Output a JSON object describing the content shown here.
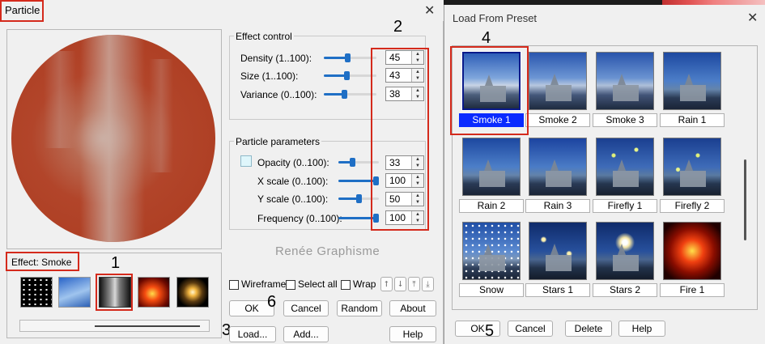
{
  "particle_dialog": {
    "title": "Particle",
    "effect_label": "Effect: Smoke",
    "watermark": "Renée Graphisme",
    "effect_control": {
      "legend": "Effect control",
      "rows": [
        {
          "label": "Density (1..100):",
          "value": "45",
          "level": 0.45
        },
        {
          "label": "Size (1..100):",
          "value": "43",
          "level": 0.43
        },
        {
          "label": "Variance (0..100):",
          "value": "38",
          "level": 0.38
        }
      ]
    },
    "particle_parameters": {
      "legend": "Particle parameters",
      "rows": [
        {
          "label": "Opacity (0..100):",
          "value": "33",
          "level": 0.33
        },
        {
          "label": "X scale (0..100):",
          "value": "100",
          "level": 1.0
        },
        {
          "label": "Y scale (0..100):",
          "value": "50",
          "level": 0.5
        },
        {
          "label": "Frequency (0..100):",
          "value": "100",
          "level": 1.0
        }
      ]
    },
    "checkboxes": {
      "wireframe": "Wireframe",
      "select_all": "Select all",
      "wrap": "Wrap"
    },
    "buttons": {
      "ok": "OK",
      "cancel": "Cancel",
      "random": "Random",
      "about": "About",
      "load": "Load...",
      "add": "Add...",
      "help": "Help"
    },
    "effect_thumbs": [
      "stars",
      "sky",
      "smoke",
      "fire",
      "burst"
    ]
  },
  "preset_dialog": {
    "title": "Load From Preset",
    "presets": [
      "Smoke 1",
      "Smoke 2",
      "Smoke 3",
      "Rain 1",
      "Rain 2",
      "Rain 3",
      "Firefly 1",
      "Firefly 2",
      "Snow",
      "Stars 1",
      "Stars 2",
      "Fire 1"
    ],
    "selected": "Smoke 1",
    "buttons": {
      "ok": "OK",
      "cancel": "Cancel",
      "delete": "Delete",
      "help": "Help"
    }
  },
  "annotations": [
    "1",
    "2",
    "3",
    "4",
    "5",
    "6"
  ],
  "colors": {
    "accent": "#1f6fc5",
    "annotation_red": "#d42a1c",
    "selection_blue": "#0a2aff"
  }
}
